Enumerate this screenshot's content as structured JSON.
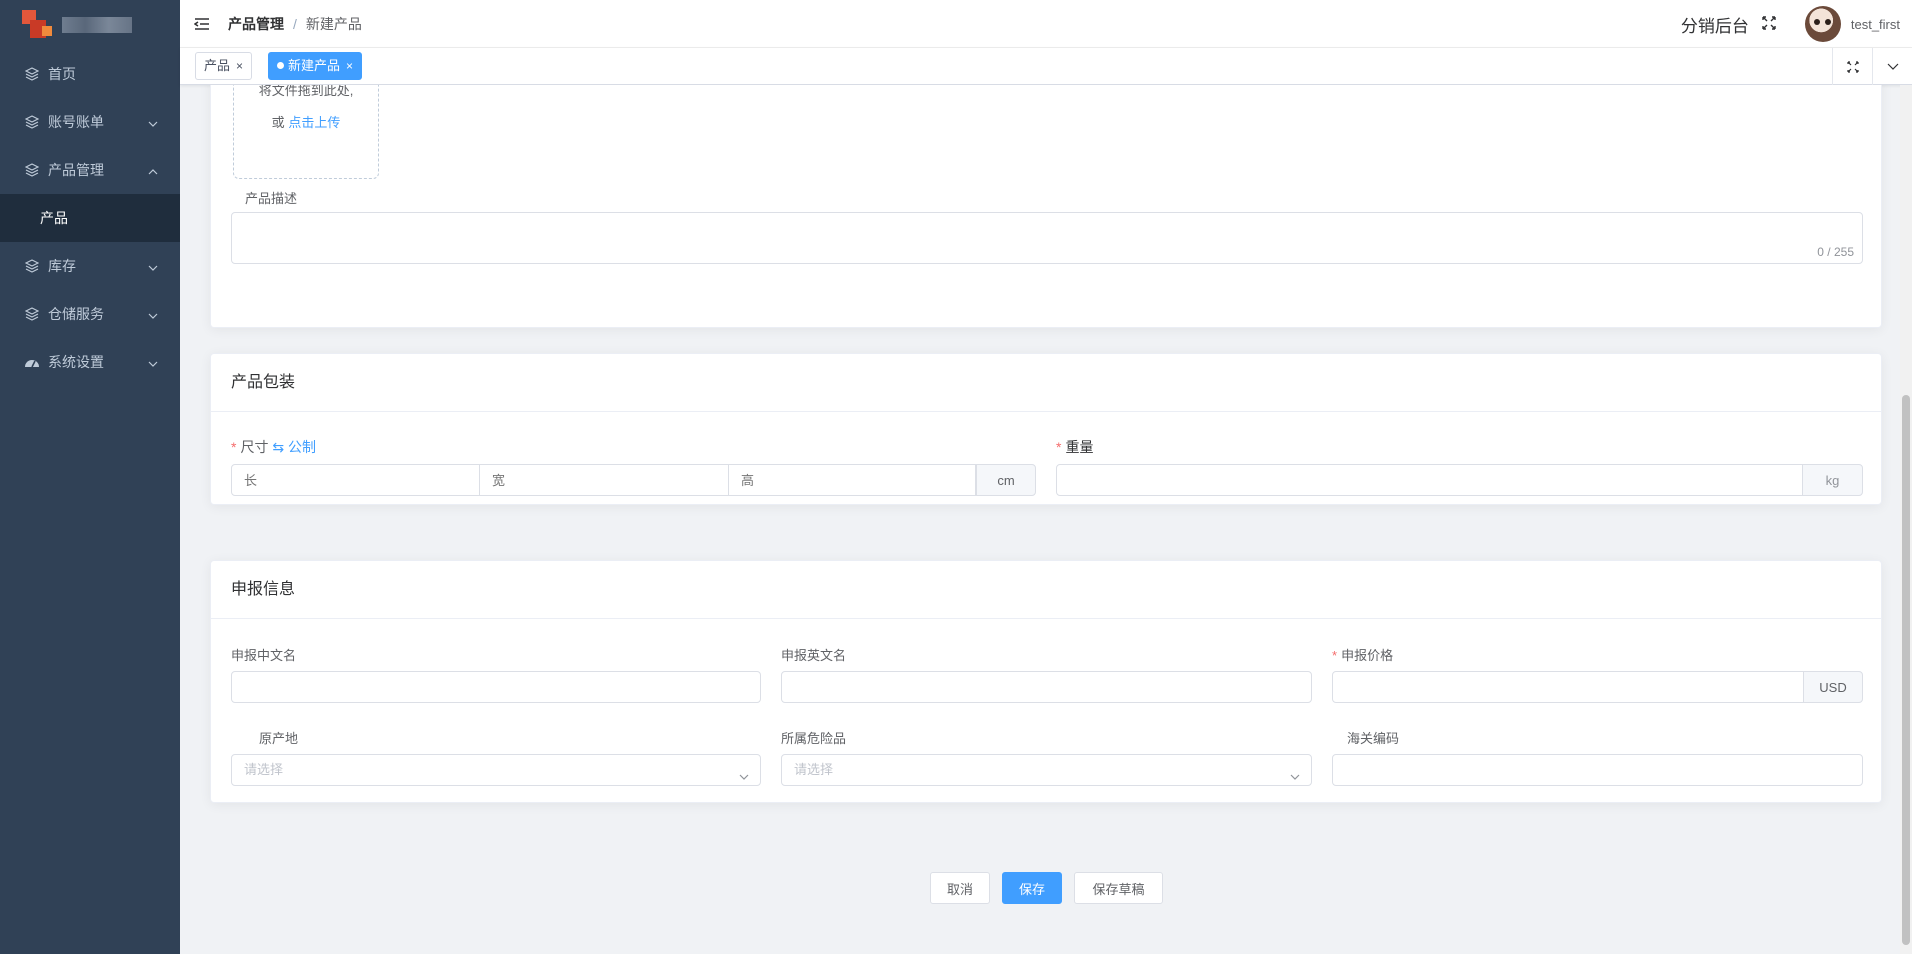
{
  "sidebar": {
    "items": [
      {
        "label": "首页",
        "icon": "layers-icon"
      },
      {
        "label": "账号账单",
        "icon": "layers-icon"
      },
      {
        "label": "产品管理",
        "icon": "layers-icon"
      },
      {
        "label": "产品"
      },
      {
        "label": "库存",
        "icon": "layers-icon"
      },
      {
        "label": "仓储服务",
        "icon": "layers-icon"
      },
      {
        "label": "系统设置",
        "icon": "dashboard-icon"
      }
    ]
  },
  "header": {
    "breadcrumb": [
      "产品管理",
      "/",
      "新建产品"
    ],
    "title": "分销后台",
    "username": "test_first"
  },
  "tags": [
    {
      "label": "产品",
      "close": "×"
    },
    {
      "label": "新建产品",
      "close": "×"
    }
  ],
  "upload": {
    "line1": "将文件拖到此处,",
    "or": "或",
    "link": "点击上传"
  },
  "description": {
    "label": "产品描述",
    "counter": "0 / 255"
  },
  "packaging": {
    "title": "产品包装",
    "size_label": "尺寸",
    "unit_toggle_icon": "⇆",
    "unit_toggle": "公制",
    "length_placeholder": "长",
    "width_placeholder": "宽",
    "height_placeholder": "高",
    "size_unit": "cm",
    "weight_label": "重量",
    "weight_unit": "kg"
  },
  "declaration": {
    "title": "申报信息",
    "cn_name_label": "申报中文名",
    "en_name_label": "申报英文名",
    "price_label": "申报价格",
    "price_unit": "USD",
    "origin_label": "原产地",
    "origin_placeholder": "请选择",
    "dangerous_label": "所属危险品",
    "dangerous_placeholder": "请选择",
    "hs_code_label": "海关编码"
  },
  "actions": {
    "cancel": "取消",
    "save": "保存",
    "save_draft": "保存草稿"
  },
  "colors": {
    "sidebar_bg": "#304156",
    "accent": "#409eff",
    "required": "#f56c6c"
  }
}
